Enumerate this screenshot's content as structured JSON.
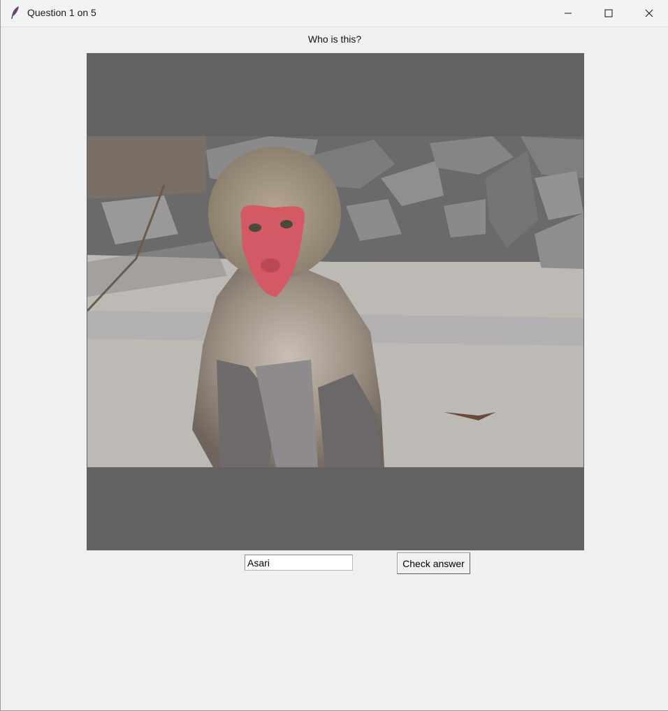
{
  "window": {
    "title": "Question 1 on 5",
    "controls": [
      "minimize-icon",
      "maximize-icon",
      "close-icon"
    ]
  },
  "quiz": {
    "question": "Who is this?",
    "image_subject": "Japanese macaque (snow monkey) sitting in front of a stone wall",
    "answer_value": "Asari",
    "check_label": "Check answer"
  },
  "colors": {
    "frame_background": "#626262",
    "window_background": "#f0f0f0"
  }
}
